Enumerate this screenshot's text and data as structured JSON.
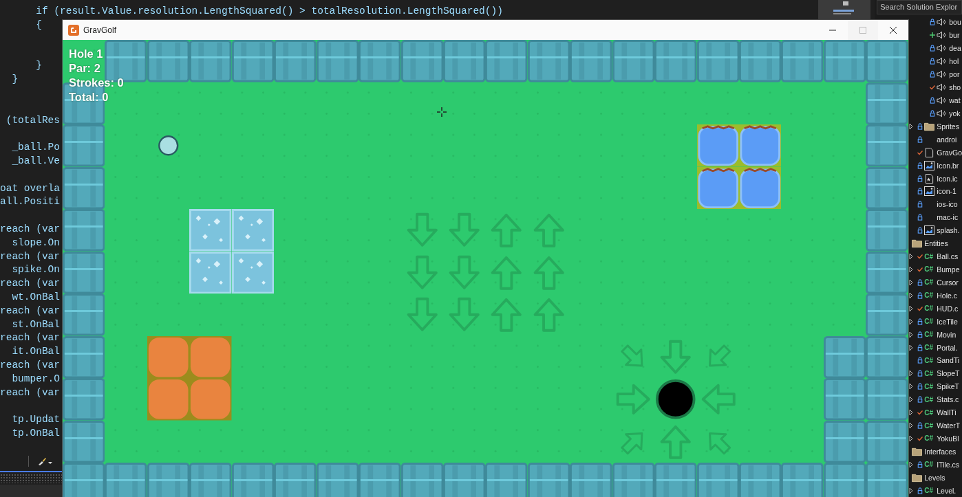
{
  "editor": {
    "first_line": "      if (result.Value.resolution.LengthSquared() > totalResolution.LengthSquared())",
    "code": "      {\n\n\n      }\n  }\n\n\n (totalRes\n\n  _ball.Po\n  _ball.Ve\n\noat overla\nall.Positi\n\nreach (var\n  slope.On\nreach (var\n  spike.On\nreach (var\n  wt.OnBal\nreach (var\n  st.OnBal\nreach (var\n  it.OnBal\nreach (var\n  bumper.O\nreach (var\n\n  tp.Updat\n  tp.OnBal"
  },
  "explorer": {
    "search": {
      "placeholder": "Search Solution Explor"
    },
    "sounds": [
      {
        "label": "bou",
        "status": {
          "kind": "locked"
        }
      },
      {
        "label": "bur",
        "status": {
          "kind": "added"
        }
      },
      {
        "label": "dea",
        "status": {
          "kind": "locked"
        }
      },
      {
        "label": "hol",
        "status": {
          "kind": "locked"
        }
      },
      {
        "label": "por",
        "status": {
          "kind": "locked"
        }
      },
      {
        "label": "sho",
        "status": {
          "kind": "modified"
        }
      },
      {
        "label": "wat",
        "status": {
          "kind": "locked"
        }
      },
      {
        "label": "yok",
        "status": {
          "kind": "locked"
        }
      }
    ],
    "content": [
      {
        "label": "Sprites",
        "kind": "folder",
        "status": {
          "kind": "locked"
        },
        "expandable": true
      },
      {
        "label": "androi",
        "kind": "plain",
        "status": {
          "kind": "locked"
        },
        "expandable": false
      },
      {
        "label": "GravGo",
        "kind": "file",
        "status": {
          "kind": "modified"
        },
        "expandable": false
      },
      {
        "label": "Icon.br",
        "kind": "image",
        "status": {
          "kind": "locked"
        },
        "expandable": false
      },
      {
        "label": "Icon.ic",
        "kind": "icofile",
        "status": {
          "kind": "locked"
        },
        "expandable": false
      },
      {
        "label": "icon-1",
        "kind": "image",
        "status": {
          "kind": "locked"
        },
        "expandable": false
      },
      {
        "label": "ios-ico",
        "kind": "plain",
        "status": {
          "kind": "locked"
        },
        "expandable": false
      },
      {
        "label": "mac-ic",
        "kind": "plain",
        "status": {
          "kind": "locked"
        },
        "expandable": false
      },
      {
        "label": "splash.",
        "kind": "image",
        "status": {
          "kind": "locked"
        },
        "expandable": false
      }
    ],
    "folders": [
      {
        "label": "Entities",
        "children": [
          {
            "badge": "C#",
            "label": "Ball.cs",
            "status": {
              "kind": "modified"
            },
            "expandable": true
          },
          {
            "badge": "C#",
            "label": "Bumpe",
            "status": {
              "kind": "modified"
            },
            "expandable": true
          },
          {
            "badge": "C#",
            "label": "Cursor",
            "status": {
              "kind": "locked"
            },
            "expandable": true
          },
          {
            "badge": "C#",
            "label": "Hole.c",
            "status": {
              "kind": "locked"
            },
            "expandable": true
          },
          {
            "badge": "C#",
            "label": "HUD.c",
            "status": {
              "kind": "modified"
            },
            "expandable": true
          },
          {
            "badge": "C#",
            "label": "IceTile",
            "status": {
              "kind": "locked"
            },
            "expandable": true
          },
          {
            "badge": "C#",
            "label": "Movin",
            "status": {
              "kind": "locked"
            },
            "expandable": true
          },
          {
            "badge": "C#",
            "label": "Portal.",
            "status": {
              "kind": "locked"
            },
            "expandable": true
          },
          {
            "badge": "C#",
            "label": "SandTi",
            "status": {
              "kind": "locked"
            },
            "expandable": false
          },
          {
            "badge": "C#",
            "label": "SlopeT",
            "status": {
              "kind": "locked"
            },
            "expandable": true
          },
          {
            "badge": "C#",
            "label": "SpikeT",
            "status": {
              "kind": "locked"
            },
            "expandable": true
          },
          {
            "badge": "C#",
            "label": "Stats.c",
            "status": {
              "kind": "locked"
            },
            "expandable": true
          },
          {
            "badge": "C#",
            "label": "WallTi",
            "status": {
              "kind": "modified"
            },
            "expandable": true
          },
          {
            "badge": "C#",
            "label": "WaterT",
            "status": {
              "kind": "locked"
            },
            "expandable": true
          },
          {
            "badge": "C#",
            "label": "YokuBl",
            "status": {
              "kind": "modified"
            },
            "expandable": true
          }
        ]
      },
      {
        "label": "Interfaces",
        "children": [
          {
            "badge": "C#",
            "label": "ITile.cs",
            "status": {
              "kind": "locked"
            },
            "expandable": true
          }
        ]
      },
      {
        "label": "Levels",
        "children": [
          {
            "badge": "C#",
            "label": "Level.",
            "status": {
              "kind": "locked"
            },
            "expandable": true
          }
        ]
      }
    ]
  },
  "window": {
    "title": "GravGolf",
    "controls": [
      {
        "kind": "minimize",
        "disabled": false
      },
      {
        "kind": "maximize",
        "disabled": true
      },
      {
        "kind": "close",
        "disabled": false
      }
    ]
  },
  "game": {
    "hud": [
      "Hole 1",
      "Par: 2",
      "Strokes: 0",
      "Total: 0"
    ],
    "level": {
      "rows": [
        [
          {
            "kind": "grass"
          },
          {
            "kind": "wall"
          },
          {
            "kind": "wall"
          },
          {
            "kind": "wall"
          },
          {
            "kind": "wall"
          },
          {
            "kind": "wall"
          },
          {
            "kind": "wall"
          },
          {
            "kind": "wall"
          },
          {
            "kind": "wall"
          },
          {
            "kind": "wall"
          },
          {
            "kind": "wall"
          },
          {
            "kind": "wall"
          },
          {
            "kind": "wall"
          },
          {
            "kind": "wall"
          },
          {
            "kind": "wall"
          },
          {
            "kind": "wall"
          },
          {
            "kind": "wall"
          },
          {
            "kind": "wall"
          },
          {
            "kind": "wall"
          },
          {
            "kind": "wall"
          }
        ],
        [
          {
            "kind": "wall"
          },
          {
            "kind": "grass"
          },
          {
            "kind": "grass"
          },
          {
            "kind": "grass"
          },
          {
            "kind": "grass"
          },
          {
            "kind": "grass"
          },
          {
            "kind": "grass"
          },
          {
            "kind": "grass"
          },
          {
            "kind": "grass"
          },
          {
            "kind": "grass"
          },
          {
            "kind": "grass"
          },
          {
            "kind": "grass"
          },
          {
            "kind": "grass"
          },
          {
            "kind": "grass"
          },
          {
            "kind": "grass"
          },
          {
            "kind": "grass"
          },
          {
            "kind": "grass"
          },
          {
            "kind": "grass"
          },
          {
            "kind": "grass"
          },
          {
            "kind": "wall"
          }
        ],
        [
          {
            "kind": "wall"
          },
          {
            "kind": "grass"
          },
          {
            "kind": "ball"
          },
          {
            "kind": "grass"
          },
          {
            "kind": "grass"
          },
          {
            "kind": "grass"
          },
          {
            "kind": "grass"
          },
          {
            "kind": "grass"
          },
          {
            "kind": "grass"
          },
          {
            "kind": "grass"
          },
          {
            "kind": "grass"
          },
          {
            "kind": "grass"
          },
          {
            "kind": "grass"
          },
          {
            "kind": "grass"
          },
          {
            "kind": "grass"
          },
          {
            "kind": "water"
          },
          {
            "kind": "water"
          },
          {
            "kind": "grass"
          },
          {
            "kind": "grass"
          },
          {
            "kind": "wall"
          }
        ],
        [
          {
            "kind": "wall"
          },
          {
            "kind": "grass"
          },
          {
            "kind": "grass"
          },
          {
            "kind": "grass"
          },
          {
            "kind": "grass"
          },
          {
            "kind": "grass"
          },
          {
            "kind": "grass"
          },
          {
            "kind": "grass"
          },
          {
            "kind": "grass"
          },
          {
            "kind": "grass"
          },
          {
            "kind": "grass"
          },
          {
            "kind": "grass"
          },
          {
            "kind": "grass"
          },
          {
            "kind": "grass"
          },
          {
            "kind": "grass"
          },
          {
            "kind": "water"
          },
          {
            "kind": "water"
          },
          {
            "kind": "grass"
          },
          {
            "kind": "grass"
          },
          {
            "kind": "wall"
          }
        ],
        [
          {
            "kind": "wall"
          },
          {
            "kind": "grass"
          },
          {
            "kind": "grass"
          },
          {
            "kind": "ice"
          },
          {
            "kind": "ice"
          },
          {
            "kind": "grass"
          },
          {
            "kind": "grass"
          },
          {
            "kind": "grass"
          },
          {
            "kind": "down"
          },
          {
            "kind": "down"
          },
          {
            "kind": "up"
          },
          {
            "kind": "up"
          },
          {
            "kind": "grass"
          },
          {
            "kind": "grass"
          },
          {
            "kind": "grass"
          },
          {
            "kind": "grass"
          },
          {
            "kind": "grass"
          },
          {
            "kind": "grass"
          },
          {
            "kind": "grass"
          },
          {
            "kind": "wall"
          }
        ],
        [
          {
            "kind": "wall"
          },
          {
            "kind": "grass"
          },
          {
            "kind": "grass"
          },
          {
            "kind": "ice"
          },
          {
            "kind": "ice"
          },
          {
            "kind": "grass"
          },
          {
            "kind": "grass"
          },
          {
            "kind": "grass"
          },
          {
            "kind": "down"
          },
          {
            "kind": "down"
          },
          {
            "kind": "up"
          },
          {
            "kind": "up"
          },
          {
            "kind": "grass"
          },
          {
            "kind": "grass"
          },
          {
            "kind": "grass"
          },
          {
            "kind": "grass"
          },
          {
            "kind": "grass"
          },
          {
            "kind": "grass"
          },
          {
            "kind": "grass"
          },
          {
            "kind": "wall"
          }
        ],
        [
          {
            "kind": "wall"
          },
          {
            "kind": "grass"
          },
          {
            "kind": "grass"
          },
          {
            "kind": "grass"
          },
          {
            "kind": "grass"
          },
          {
            "kind": "grass"
          },
          {
            "kind": "grass"
          },
          {
            "kind": "grass"
          },
          {
            "kind": "down"
          },
          {
            "kind": "down"
          },
          {
            "kind": "up"
          },
          {
            "kind": "up"
          },
          {
            "kind": "grass"
          },
          {
            "kind": "grass"
          },
          {
            "kind": "grass"
          },
          {
            "kind": "grass"
          },
          {
            "kind": "grass"
          },
          {
            "kind": "grass"
          },
          {
            "kind": "grass"
          },
          {
            "kind": "wall"
          }
        ],
        [
          {
            "kind": "wall"
          },
          {
            "kind": "grass"
          },
          {
            "kind": "sand"
          },
          {
            "kind": "sand"
          },
          {
            "kind": "grass"
          },
          {
            "kind": "grass"
          },
          {
            "kind": "grass"
          },
          {
            "kind": "grass"
          },
          {
            "kind": "grass"
          },
          {
            "kind": "grass"
          },
          {
            "kind": "grass"
          },
          {
            "kind": "grass"
          },
          {
            "kind": "grass"
          },
          {
            "kind": "downright"
          },
          {
            "kind": "down"
          },
          {
            "kind": "downleft"
          },
          {
            "kind": "grass"
          },
          {
            "kind": "grass"
          },
          {
            "kind": "wall"
          },
          {
            "kind": "wall"
          }
        ],
        [
          {
            "kind": "wall"
          },
          {
            "kind": "grass"
          },
          {
            "kind": "sand"
          },
          {
            "kind": "sand"
          },
          {
            "kind": "grass"
          },
          {
            "kind": "grass"
          },
          {
            "kind": "grass"
          },
          {
            "kind": "grass"
          },
          {
            "kind": "grass"
          },
          {
            "kind": "grass"
          },
          {
            "kind": "grass"
          },
          {
            "kind": "grass"
          },
          {
            "kind": "grass"
          },
          {
            "kind": "right"
          },
          {
            "kind": "hole"
          },
          {
            "kind": "left"
          },
          {
            "kind": "grass"
          },
          {
            "kind": "grass"
          },
          {
            "kind": "wall"
          },
          {
            "kind": "wall"
          }
        ],
        [
          {
            "kind": "wall"
          },
          {
            "kind": "grass"
          },
          {
            "kind": "grass"
          },
          {
            "kind": "grass"
          },
          {
            "kind": "grass"
          },
          {
            "kind": "grass"
          },
          {
            "kind": "grass"
          },
          {
            "kind": "grass"
          },
          {
            "kind": "grass"
          },
          {
            "kind": "grass"
          },
          {
            "kind": "grass"
          },
          {
            "kind": "grass"
          },
          {
            "kind": "grass"
          },
          {
            "kind": "upright"
          },
          {
            "kind": "up"
          },
          {
            "kind": "upleft"
          },
          {
            "kind": "grass"
          },
          {
            "kind": "grass"
          },
          {
            "kind": "wall"
          },
          {
            "kind": "wall"
          }
        ],
        [
          {
            "kind": "wall"
          },
          {
            "kind": "wall"
          },
          {
            "kind": "wall"
          },
          {
            "kind": "wall"
          },
          {
            "kind": "wall"
          },
          {
            "kind": "wall"
          },
          {
            "kind": "wall"
          },
          {
            "kind": "wall"
          },
          {
            "kind": "wall"
          },
          {
            "kind": "wall"
          },
          {
            "kind": "wall"
          },
          {
            "kind": "wall"
          },
          {
            "kind": "wall"
          },
          {
            "kind": "wall"
          },
          {
            "kind": "wall"
          },
          {
            "kind": "wall"
          },
          {
            "kind": "wall"
          },
          {
            "kind": "wall"
          },
          {
            "kind": "wall"
          },
          {
            "kind": "wall"
          }
        ]
      ]
    }
  }
}
